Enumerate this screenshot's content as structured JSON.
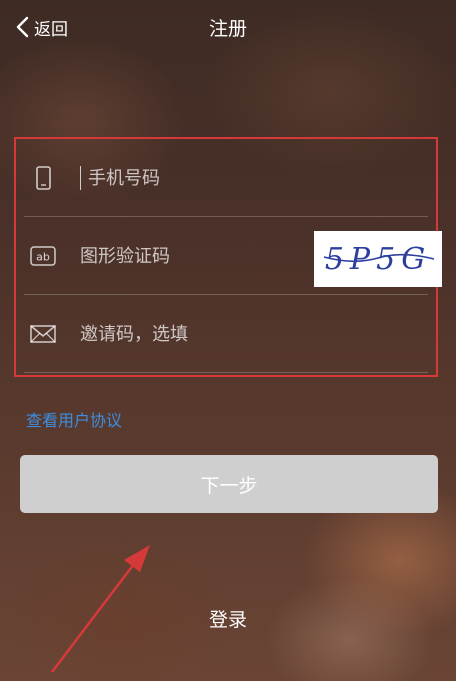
{
  "header": {
    "back_label": "返回",
    "title": "注册"
  },
  "form": {
    "phone_placeholder": "手机号码",
    "captcha_placeholder": "图形验证码",
    "captcha_text": "5P5G",
    "invite_placeholder": "邀请码，选填",
    "captcha_icon_text": "ab"
  },
  "links": {
    "agreement": "查看用户协议",
    "login": "登录"
  },
  "buttons": {
    "next": "下一步"
  },
  "colors": {
    "highlight_border": "#d6393a",
    "link": "#3d8ee0",
    "button_bg": "#cfcfcf",
    "captcha_ink": "#2c3f9e"
  },
  "icons": [
    "back-chevron-icon",
    "phone-icon",
    "captcha-ab-icon",
    "envelope-icon",
    "annotation-arrow-icon"
  ]
}
